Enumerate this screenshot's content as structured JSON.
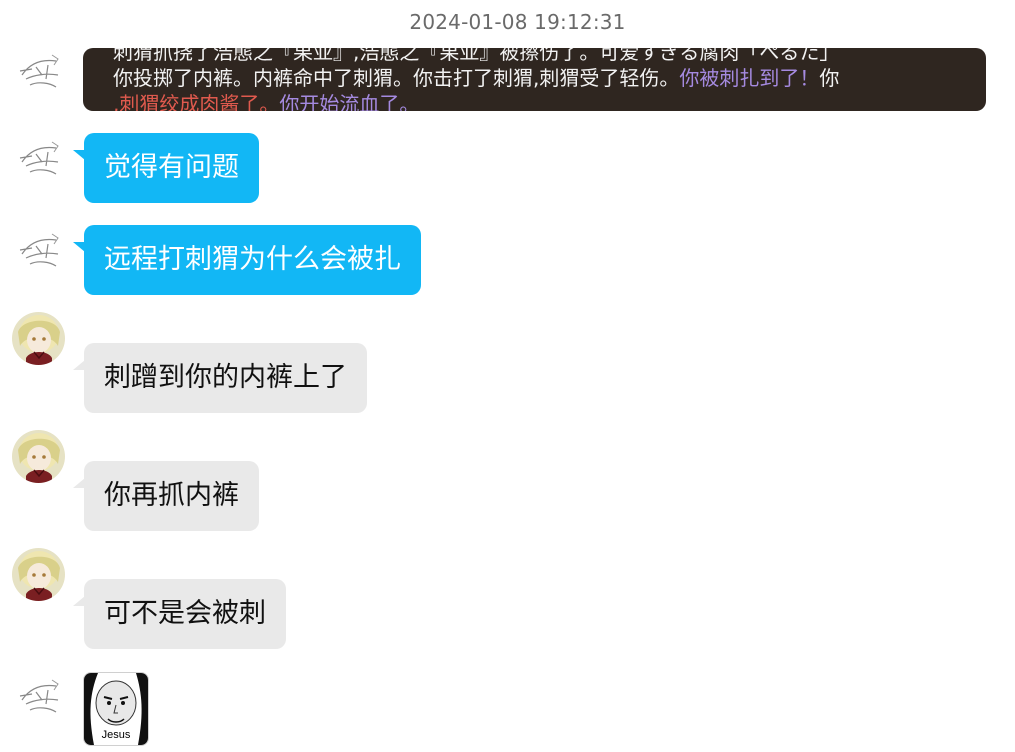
{
  "timestamp": "2024-01-08 19:12:31",
  "card": {
    "line1": "刺猬抓挠了浩態之『果亚』,浩態之『果亚』被擦伤了。可爱すぎる腐肉「ぺるた」",
    "line2_white": "你投掷了内裤。内裤命中了刺猬。你击打了刺猬,刺猬受了轻伤。",
    "line2_purple": "你被刺扎到了！",
    "line2_tail": "你",
    "line3_red": ",刺猬绞成肉酱了。",
    "line3_purple": "你开始流血了。"
  },
  "messages": [
    {
      "text": "觉得有问题",
      "style": "blue"
    },
    {
      "text": "远程打刺猬为什么会被扎",
      "style": "blue"
    },
    {
      "text": "刺蹭到你的内裤上了",
      "style": "gray"
    },
    {
      "text": "你再抓内裤",
      "style": "gray"
    },
    {
      "text": "可不是会被刺",
      "style": "gray"
    }
  ],
  "sticker": {
    "caption": "Jesus"
  },
  "colors": {
    "blue_bubble": "#12b7f5",
    "gray_bubble": "#e9e9e9",
    "card_bg": "#2f2620",
    "purple_text": "#a58ae0",
    "red_text": "#e05a4e"
  }
}
